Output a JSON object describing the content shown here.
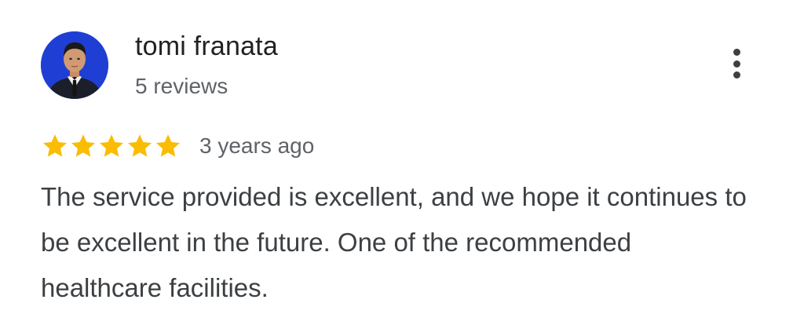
{
  "reviewer": {
    "name": "tomi franata",
    "review_count": "5 reviews",
    "avatar_bg_color": "#1f3fd4"
  },
  "rating": {
    "stars": 5,
    "max_stars": 5,
    "star_color": "#fbbc04",
    "time": "3 years ago"
  },
  "review": {
    "text": "The service provided is excellent, and we hope it continues to be excellent in the future. One of the recommended healthcare facilities."
  },
  "actions": {
    "more_icon": "more-vert-icon"
  }
}
